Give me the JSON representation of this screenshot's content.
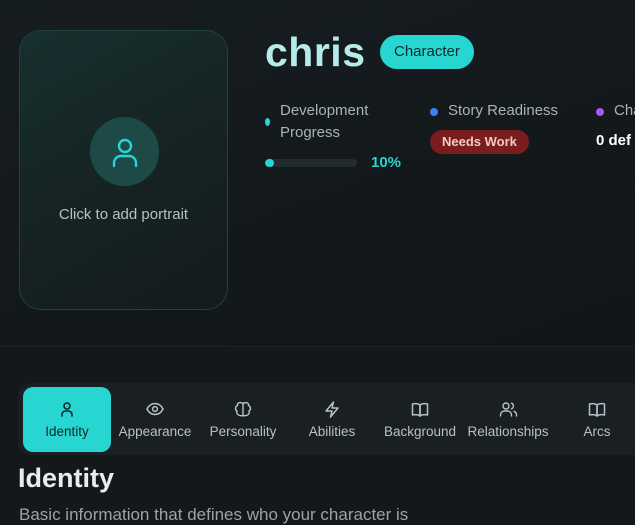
{
  "portrait": {
    "label": "Click to add portrait",
    "icon": "user-icon"
  },
  "character": {
    "name": "chris",
    "badge": "Character"
  },
  "stats": {
    "development": {
      "label_line1": "Development",
      "label_line2": "Progress",
      "value_text": "10%",
      "value": 10,
      "color": "#27d6d0"
    },
    "story_readiness": {
      "label": "Story Readiness",
      "status": "Needs Work",
      "color": "#3b82f6"
    },
    "definitions": {
      "label": "Cha",
      "value_text": "0 def",
      "color": "#a855f7"
    }
  },
  "tabs": [
    {
      "label": "Identity",
      "icon": "user-icon",
      "active": true
    },
    {
      "label": "Appearance",
      "icon": "eye-icon",
      "active": false
    },
    {
      "label": "Personality",
      "icon": "brain-icon",
      "active": false
    },
    {
      "label": "Abilities",
      "icon": "lightning-icon",
      "active": false
    },
    {
      "label": "Background",
      "icon": "book-open-icon",
      "active": false
    },
    {
      "label": "Relationships",
      "icon": "users-icon",
      "active": false
    },
    {
      "label": "Arcs",
      "icon": "book-open-icon",
      "active": false
    }
  ],
  "section": {
    "title": "Identity",
    "subtitle": "Basic information that defines who your character is"
  }
}
